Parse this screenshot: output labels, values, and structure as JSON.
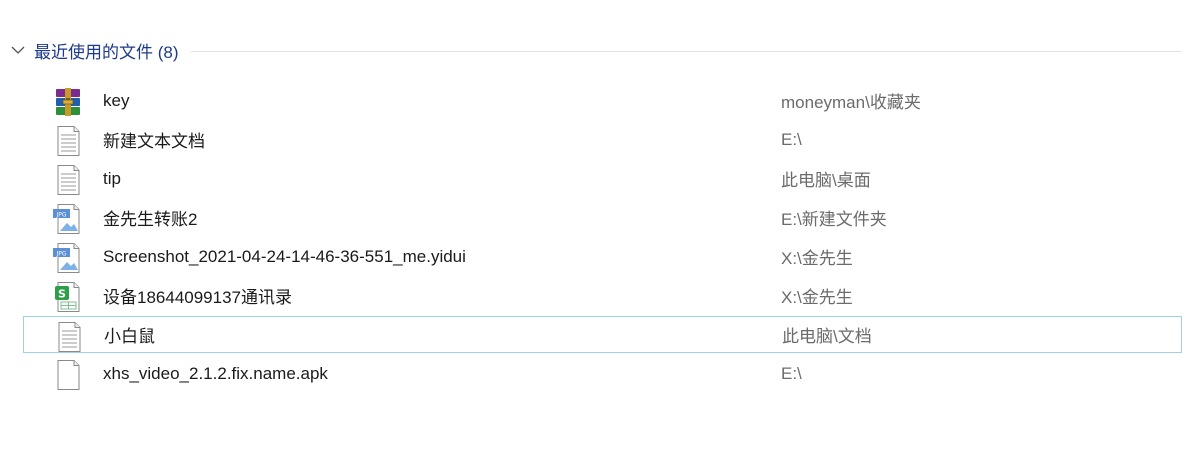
{
  "group": {
    "title": "最近使用的文件 (8)"
  },
  "files": [
    {
      "name": "key",
      "path": "moneyman\\收藏夹",
      "icon": "winrar-archive-icon"
    },
    {
      "name": "新建文本文档",
      "path": "E:\\",
      "icon": "text-document-icon"
    },
    {
      "name": "tip",
      "path": "此电脑\\桌面",
      "icon": "text-document-icon"
    },
    {
      "name": "金先生转账2",
      "path": "E:\\新建文件夹",
      "icon": "jpg-image-icon"
    },
    {
      "name": "Screenshot_2021-04-24-14-46-36-551_me.yidui",
      "path": "X:\\金先生",
      "icon": "jpg-image-icon"
    },
    {
      "name": "设备18644099137通讯录",
      "path": "X:\\金先生",
      "icon": "spreadsheet-icon"
    },
    {
      "name": "小白鼠",
      "path": "此电脑\\文档",
      "icon": "text-document-icon"
    },
    {
      "name": "xhs_video_2.1.2.fix.name.apk",
      "path": "E:\\",
      "icon": "blank-file-icon"
    }
  ],
  "colors": {
    "group_title": "#1e3a8a",
    "selected_border": "#9bd2e6",
    "path_text": "#6b6b6b"
  }
}
